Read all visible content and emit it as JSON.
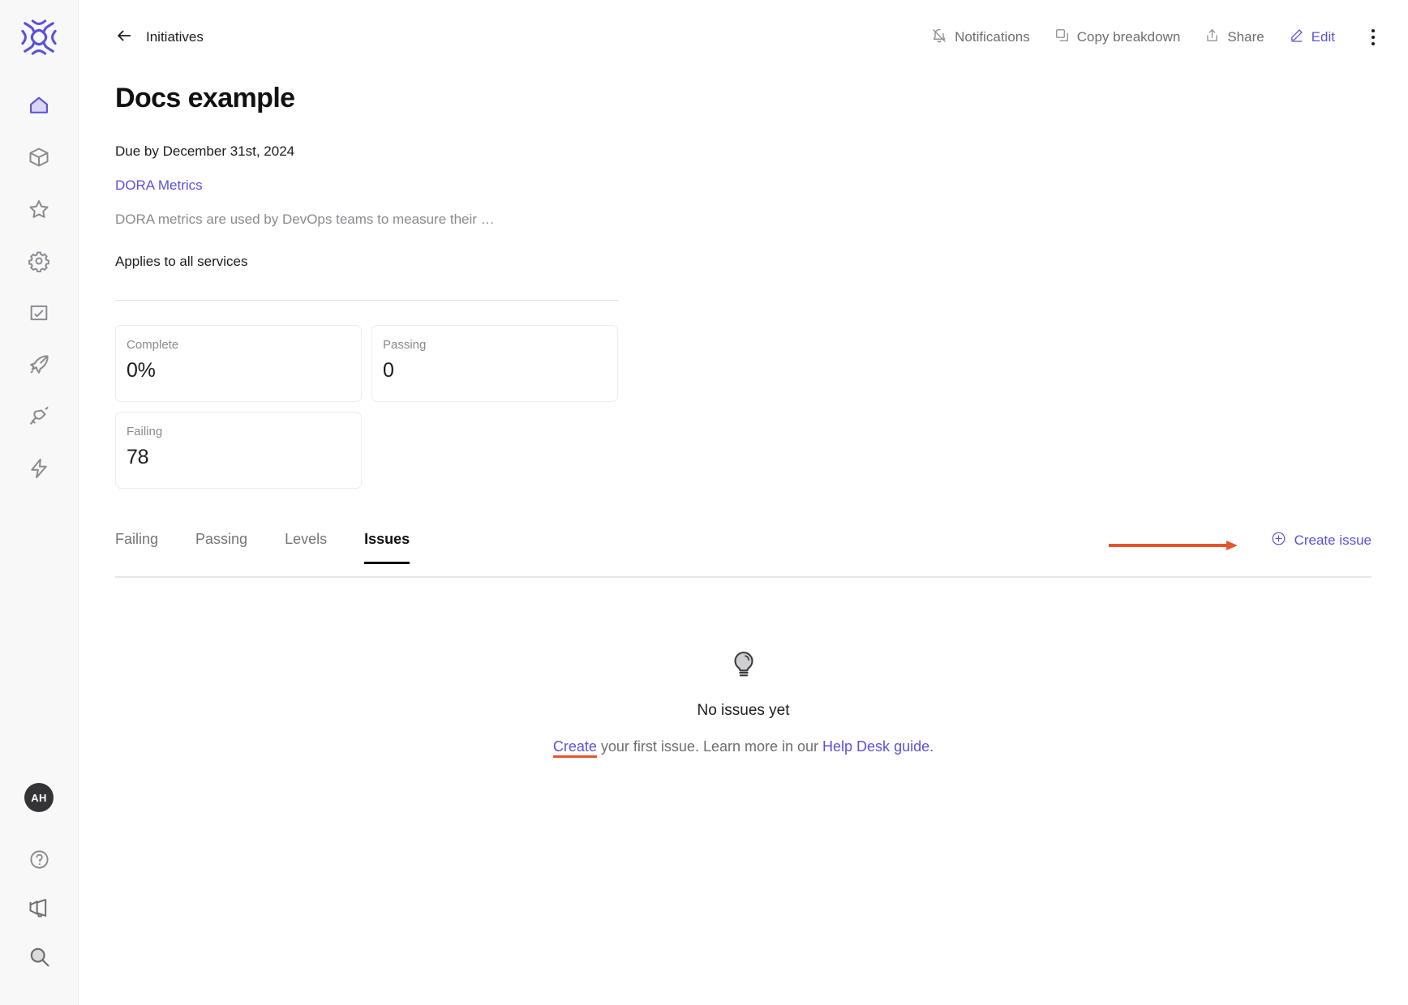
{
  "colors": {
    "brand_purple": "#5b51d8",
    "annotation_orange": "#e8552c",
    "sidebar_bg": "#f8f8f9",
    "text_primary": "#1c1c1e",
    "text_muted": "#8a8a8f"
  },
  "sidebar": {
    "logo_name": "cortex-logo",
    "top_items": [
      {
        "name": "home-icon",
        "label": "Home",
        "active": true
      },
      {
        "name": "cube-icon",
        "label": "Catalog",
        "active": false
      },
      {
        "name": "star-icon",
        "label": "Scorecards",
        "active": false
      },
      {
        "name": "gear-icon",
        "label": "Settings",
        "active": false
      },
      {
        "name": "checklist-icon",
        "label": "Initiatives",
        "active": false
      },
      {
        "name": "rocket-icon",
        "label": "Launch",
        "active": false
      },
      {
        "name": "plug-icon",
        "label": "Integrations",
        "active": false
      },
      {
        "name": "lightning-icon",
        "label": "Actions",
        "active": false
      }
    ],
    "avatar_initials": "AH",
    "bottom_items": [
      {
        "name": "help-circle-icon",
        "label": "Help"
      },
      {
        "name": "megaphone-icon",
        "label": "Announcements"
      },
      {
        "name": "search-icon",
        "label": "Search"
      }
    ]
  },
  "topbar": {
    "back_icon": "arrow-left-icon",
    "breadcrumb": "Initiatives",
    "actions": [
      {
        "name": "notifications-button",
        "label": "Notifications",
        "icon": "bell-off-icon",
        "accent": false
      },
      {
        "name": "copy-breakdown-button",
        "label": "Copy breakdown",
        "icon": "copy-icon",
        "accent": false
      },
      {
        "name": "share-button",
        "label": "Share",
        "icon": "share-icon",
        "accent": false
      },
      {
        "name": "edit-button",
        "label": "Edit",
        "icon": "pencil-icon",
        "accent": true
      }
    ],
    "overflow_icon": "kebab-menu-icon"
  },
  "page": {
    "title": "Docs example",
    "due": "Due by December 31st, 2024",
    "ruleset_link": "DORA Metrics",
    "ruleset_description": "DORA metrics are used by DevOps teams to measure their …",
    "applies_to": "Applies to all services"
  },
  "stats": [
    {
      "label": "Complete",
      "value": "0%"
    },
    {
      "label": "Passing",
      "value": "0"
    },
    {
      "label": "Failing",
      "value": "78"
    }
  ],
  "tabs": [
    {
      "label": "Failing",
      "active": false
    },
    {
      "label": "Passing",
      "active": false
    },
    {
      "label": "Levels",
      "active": false
    },
    {
      "label": "Issues",
      "active": true
    }
  ],
  "create_issue": {
    "label": "Create issue",
    "icon": "plus-circle-icon"
  },
  "empty_state": {
    "icon": "lightbulb-icon",
    "title": "No issues yet",
    "link_create": "Create",
    "text_middle": " your first issue. Learn more in our ",
    "link_guide": "Help Desk guide",
    "text_end": "."
  }
}
